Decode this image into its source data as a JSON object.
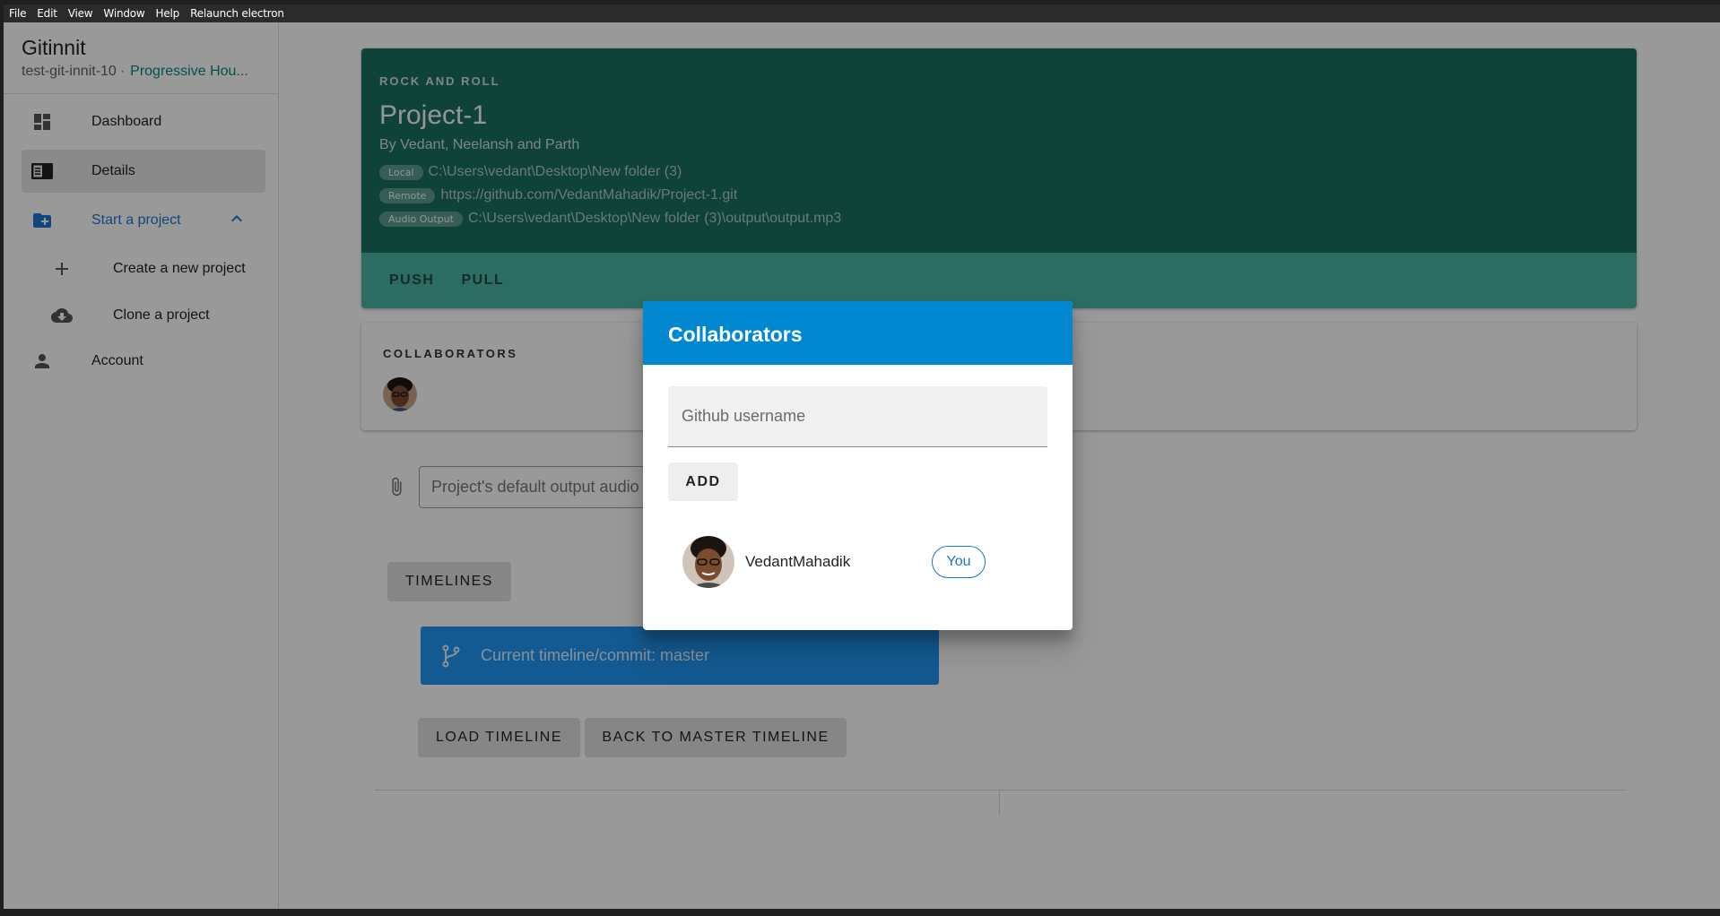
{
  "menubar": {
    "items": [
      "File",
      "Edit",
      "View",
      "Window",
      "Help",
      "Relaunch electron"
    ]
  },
  "sidebar": {
    "app_title": "Gitinnit",
    "repo_name": "test-git-innit-10",
    "separator": "·",
    "genre": "Progressive Hou...",
    "items": [
      {
        "label": "Dashboard",
        "icon": "dashboard-icon"
      },
      {
        "label": "Details",
        "icon": "details-icon",
        "active": true
      },
      {
        "label": "Start a project",
        "icon": "folder-add-icon",
        "expanded": true
      },
      {
        "label": "Create a new project",
        "icon": "plus-icon"
      },
      {
        "label": "Clone a project",
        "icon": "cloud-download-icon"
      },
      {
        "label": "Account",
        "icon": "person-icon"
      }
    ]
  },
  "project": {
    "overline": "ROCK AND ROLL",
    "title": "Project-1",
    "authors": "By Vedant, Neelansh and Parth",
    "paths": [
      {
        "chip": "Local",
        "value": "C:\\Users\\vedant\\Desktop\\New folder (3)"
      },
      {
        "chip": "Remote",
        "value": "https://github.com/VedantMahadik/Project-1.git"
      },
      {
        "chip": "Audio Output",
        "value": "C:\\Users\\vedant\\Desktop\\New folder (3)\\output\\output.mp3"
      }
    ],
    "actions": {
      "push": "PUSH",
      "pull": "PULL"
    }
  },
  "collaborators_card": {
    "label": "COLLABORATORS"
  },
  "output_field": {
    "placeholder": "Project's default output audio"
  },
  "timelines": {
    "button": "TIMELINES",
    "current": "Current timeline/commit: master",
    "load": "LOAD TIMELINE",
    "back": "BACK TO MASTER TIMELINE"
  },
  "dialog": {
    "title": "Collaborators",
    "input_placeholder": "Github username",
    "add_label": "ADD",
    "users": [
      {
        "name": "VedantMahadik",
        "badge": "You"
      }
    ]
  },
  "colors": {
    "project_header": "#1a7060",
    "project_actions": "#4ab6a6",
    "dialog_header": "#0288d1",
    "timeline_bar": "#2196f3",
    "accent_blue": "#1976d2",
    "genre_green": "#00897b"
  }
}
